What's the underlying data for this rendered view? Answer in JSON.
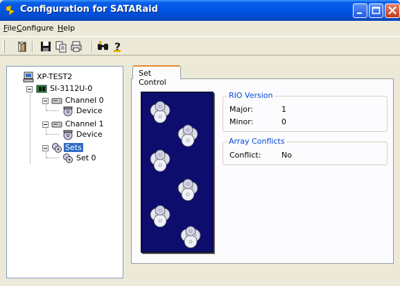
{
  "window": {
    "title": "Configuration for SATARaid"
  },
  "menu": [
    {
      "label": "File"
    },
    {
      "label": "Configure"
    },
    {
      "label": "Help"
    }
  ],
  "toolbar": {
    "icons": [
      "exit-icon",
      "save-icon",
      "copy-icon",
      "print-icon",
      "find-icon",
      "help-icon"
    ]
  },
  "tree": {
    "root": "XP-TEST2",
    "controller": "SI-3112U-0",
    "channel0": "Channel 0",
    "device0": "Device",
    "channel1": "Channel 1",
    "device1": "Device",
    "sets": "Sets",
    "set0": "Set 0"
  },
  "tab": {
    "label": "Set Control"
  },
  "rio": {
    "title": "RIO Version",
    "major_label": "Major:",
    "major_value": "1",
    "minor_label": "Minor:",
    "minor_value": "0"
  },
  "conflicts": {
    "title": "Array Conflicts",
    "conflict_label": "Conflict:",
    "conflict_value": "No"
  },
  "colors": {
    "titlebar": "#0054e3",
    "selection": "#316ac5",
    "art_background": "#0d0d6d",
    "group_title": "#0046d5"
  }
}
